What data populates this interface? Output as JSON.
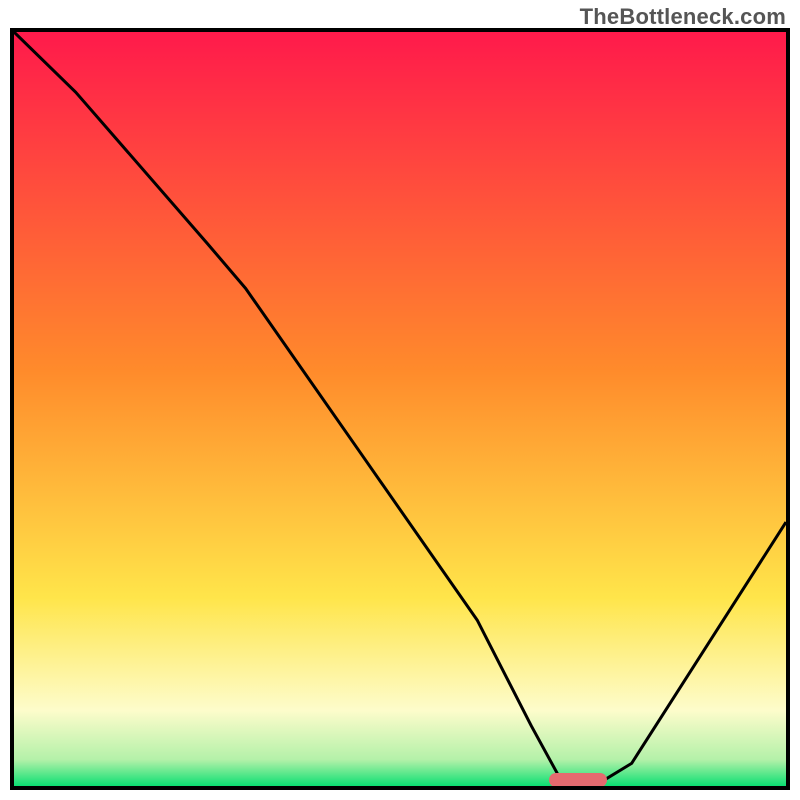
{
  "watermark": "TheBottleneck.com",
  "chart_data": {
    "type": "line",
    "title": "",
    "xlabel": "",
    "ylabel": "",
    "xlim": [
      0,
      100
    ],
    "ylim": [
      0,
      100
    ],
    "grid": false,
    "background_gradient": {
      "stops": [
        {
          "offset": 0.0,
          "color": "#ff1a4b"
        },
        {
          "offset": 0.45,
          "color": "#ff8b2b"
        },
        {
          "offset": 0.75,
          "color": "#ffe54a"
        },
        {
          "offset": 0.9,
          "color": "#fdfccb"
        },
        {
          "offset": 0.965,
          "color": "#b4f1a9"
        },
        {
          "offset": 1.0,
          "color": "#0bdf72"
        }
      ]
    },
    "series": [
      {
        "name": "curve",
        "color": "#000000",
        "width": 3,
        "x": [
          0,
          8,
          25,
          30,
          45,
          60,
          67,
          71,
          76,
          80,
          100
        ],
        "y": [
          100,
          92,
          72,
          66,
          44,
          22,
          8,
          0.5,
          0.5,
          3,
          35
        ]
      }
    ],
    "marker": {
      "name": "optimum-marker",
      "color": "#e46a6f",
      "x_center": 73,
      "width_pct": 7.5,
      "y_pct": 0.8,
      "height_pct": 1.8,
      "radius": 8
    }
  }
}
